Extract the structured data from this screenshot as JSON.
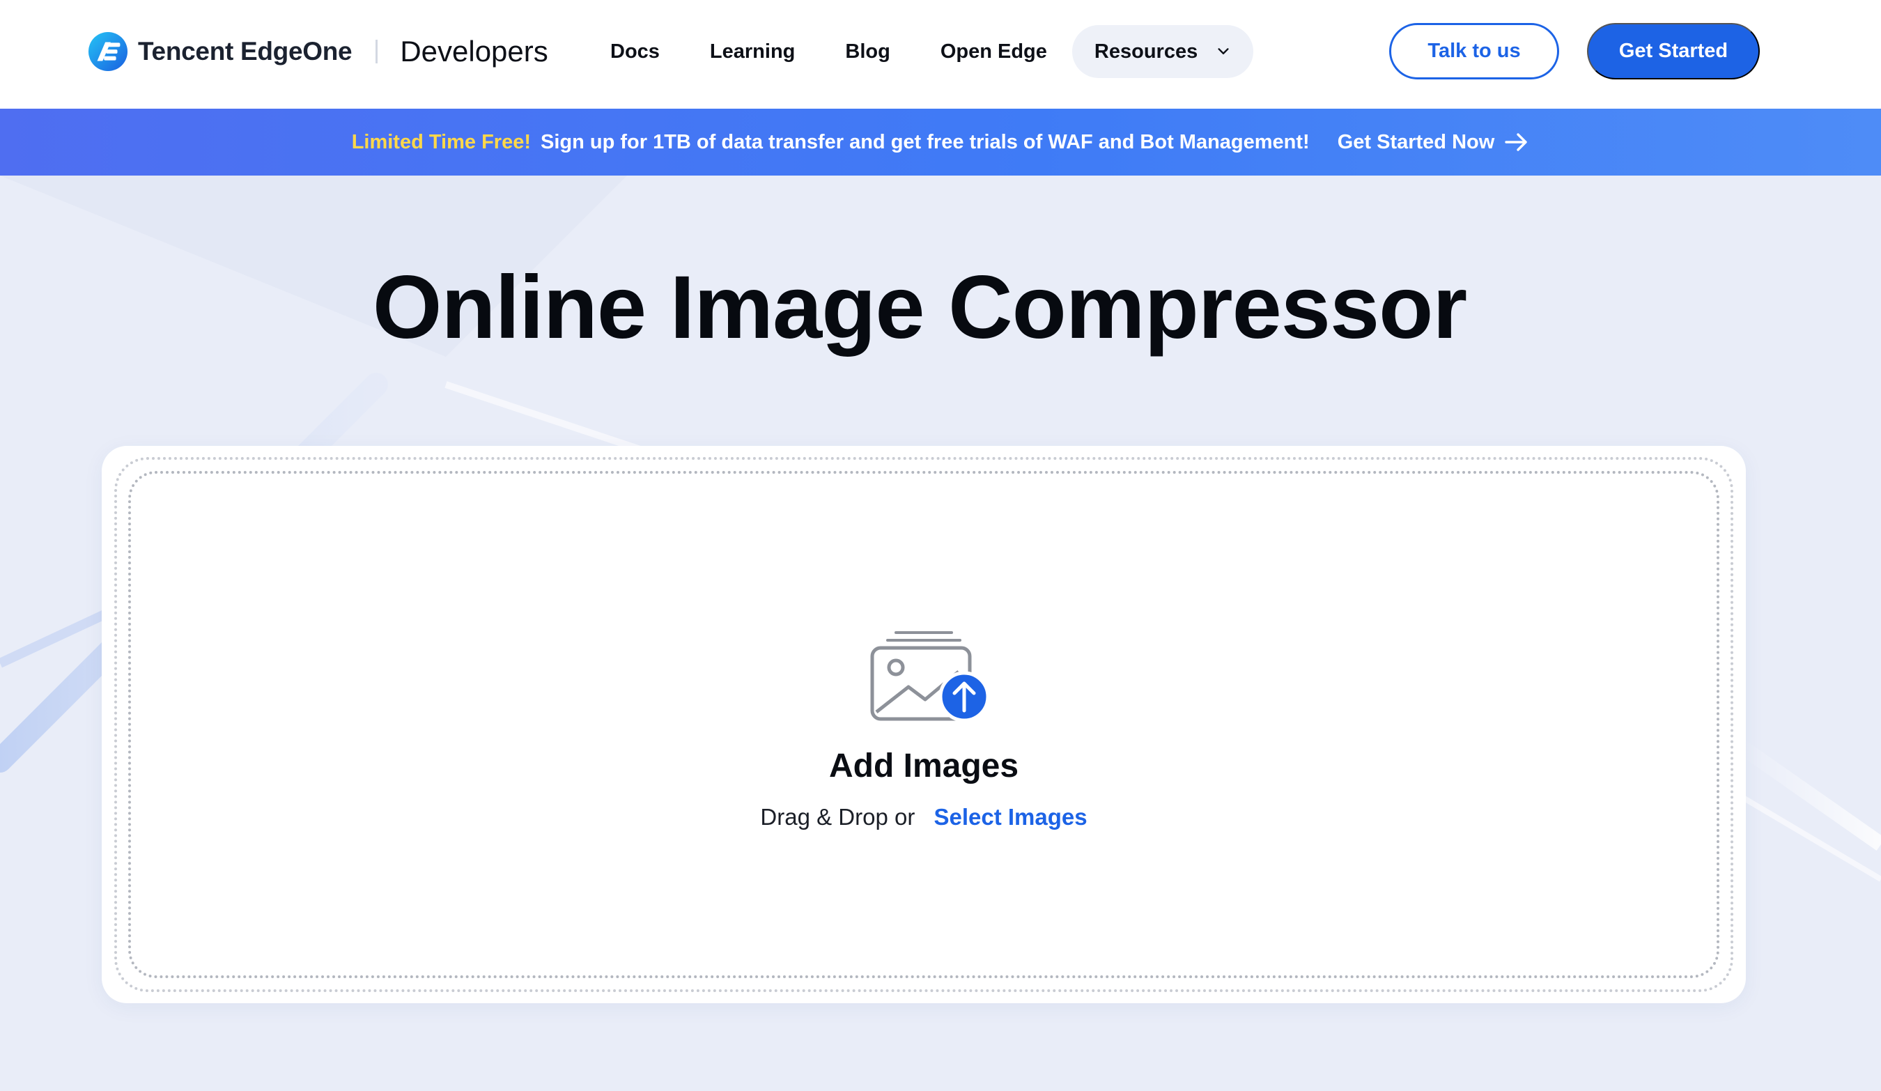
{
  "header": {
    "brand_name": "Tencent EdgeOne",
    "brand_sub": "Developers",
    "nav": [
      "Docs",
      "Learning",
      "Blog",
      "Open Edge"
    ],
    "resources_label": "Resources",
    "talk_label": "Talk to us",
    "start_label": "Get Started"
  },
  "banner": {
    "highlight": "Limited Time Free!",
    "text": "Sign up for 1TB of data transfer and get free trials of WAF and Bot Management!",
    "link": "Get Started Now"
  },
  "main": {
    "title": "Online Image Compressor",
    "upload": {
      "title": "Add Images",
      "prefix": "Drag & Drop or",
      "link": "Select Images"
    }
  },
  "icons": {
    "logo": "edgeone-logo-icon",
    "resources": "chevron-down-icon",
    "banner_arrow": "arrow-right-icon",
    "upload": "image-upload-icon"
  },
  "colors": {
    "accent": "#1d63e5",
    "banner_highlight": "#ffd84a",
    "page_bg": "#e9edf8"
  }
}
